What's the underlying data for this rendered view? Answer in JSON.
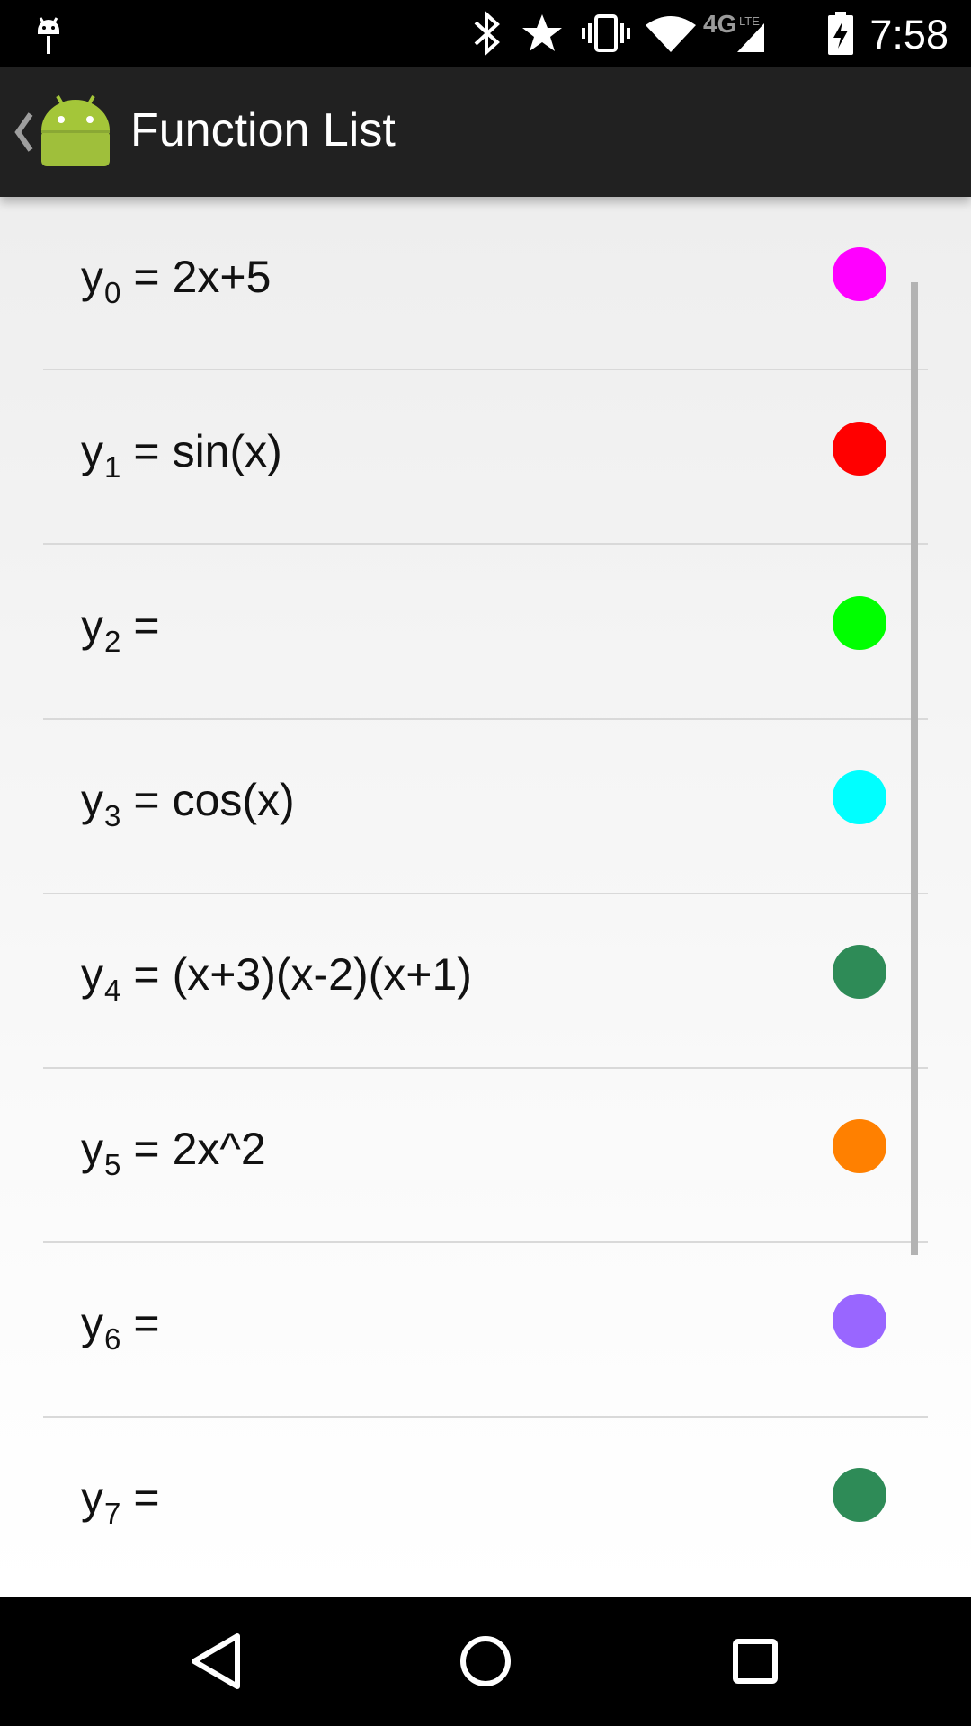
{
  "status_bar": {
    "time": "7:58",
    "icons": [
      "android-debug-icon",
      "bluetooth-icon",
      "star-icon",
      "vibrate-icon",
      "wifi-icon",
      "4g-lte-icon",
      "signal-icon",
      "battery-charging-icon"
    ]
  },
  "action_bar": {
    "title": "Function List",
    "up_icon": "up-caret-icon",
    "app_icon": "android-app-icon"
  },
  "functions": [
    {
      "var": "y",
      "index": "0",
      "eq": "=",
      "expr": "2x+5",
      "color": "#FF00FF"
    },
    {
      "var": "y",
      "index": "1",
      "eq": "=",
      "expr": "sin(x)",
      "color": "#FF0000"
    },
    {
      "var": "y",
      "index": "2",
      "eq": "=",
      "expr": "",
      "color": "#00FF00"
    },
    {
      "var": "y",
      "index": "3",
      "eq": "=",
      "expr": "cos(x)",
      "color": "#00FFFF"
    },
    {
      "var": "y",
      "index": "4",
      "eq": "=",
      "expr": "(x+3)(x-2)(x+1)",
      "color": "#2E8B57"
    },
    {
      "var": "y",
      "index": "5",
      "eq": "=",
      "expr": "2x^2",
      "color": "#FF8000"
    },
    {
      "var": "y",
      "index": "6",
      "eq": "=",
      "expr": "",
      "color": "#9966FF"
    },
    {
      "var": "y",
      "index": "7",
      "eq": "=",
      "expr": "",
      "color": "#2E8B57"
    }
  ],
  "nav_bar": {
    "back": "back-triangle-icon",
    "home": "home-circle-icon",
    "recents": "recents-square-icon"
  }
}
